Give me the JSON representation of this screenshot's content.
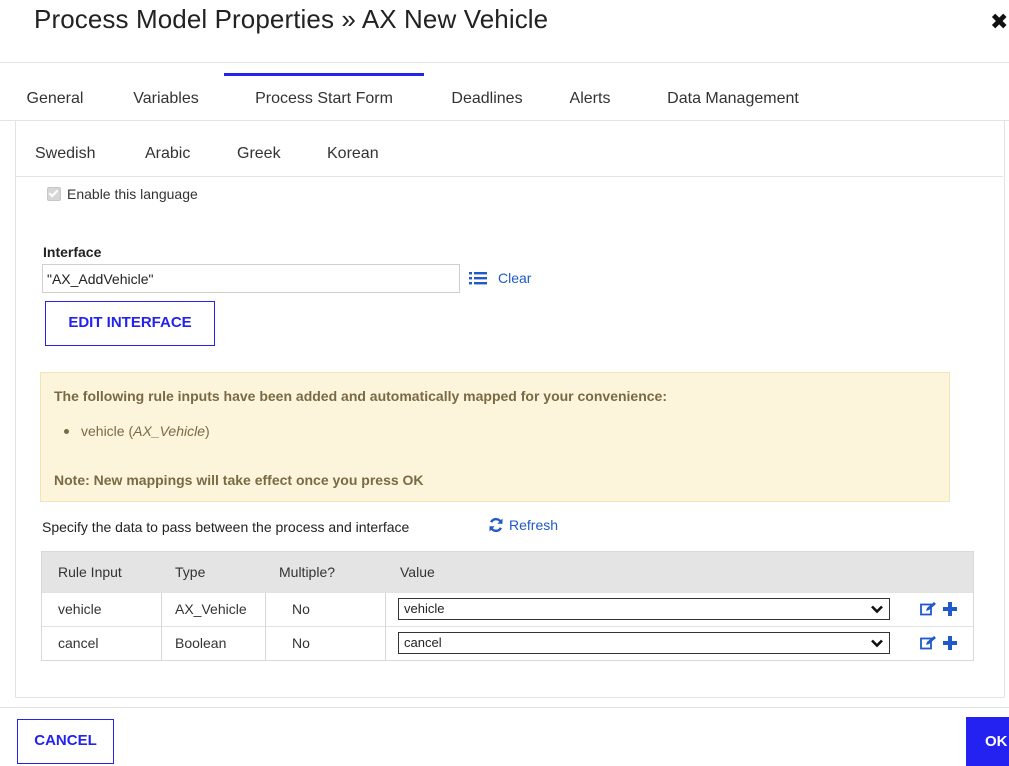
{
  "dialog": {
    "title": "Process Model Properties » AX New Vehicle",
    "close_icon": "close-icon"
  },
  "tabs": [
    {
      "label": "General",
      "active": false
    },
    {
      "label": "Variables",
      "active": false
    },
    {
      "label": "Process Start Form",
      "active": true
    },
    {
      "label": "Deadlines",
      "active": false
    },
    {
      "label": "Alerts",
      "active": false
    },
    {
      "label": "Data Management",
      "active": false
    }
  ],
  "languages": [
    "Swedish",
    "Arabic",
    "Greek",
    "Korean"
  ],
  "enable_language": {
    "label": "Enable this language",
    "checked": true,
    "disabled": true
  },
  "interface": {
    "label": "Interface",
    "value": "\"AX_AddVehicle\"",
    "list_icon": "list-icon",
    "clear_label": "Clear",
    "edit_button": "EDIT INTERFACE"
  },
  "notice": {
    "heading": "The following rule inputs have been added and automatically mapped for your convenience:",
    "items": [
      {
        "name": "vehicle",
        "type": "AX_Vehicle"
      }
    ],
    "note": "Note: New mappings will take effect once you press OK"
  },
  "mapping": {
    "description": "Specify the data to pass between the process and interface",
    "refresh_label": "Refresh",
    "headers": [
      "Rule Input",
      "Type",
      "Multiple?",
      "Value"
    ],
    "rows": [
      {
        "rule_input": "vehicle",
        "type": "AX_Vehicle",
        "multiple": "No",
        "value": "vehicle"
      },
      {
        "rule_input": "cancel",
        "type": "Boolean",
        "multiple": "No",
        "value": "cancel"
      }
    ],
    "row_icons": [
      "edit-icon",
      "plus-icon"
    ]
  },
  "footer": {
    "cancel_label": "CANCEL",
    "ok_label": "OK"
  },
  "colors": {
    "accent": "#2322f0",
    "link": "#2059c9",
    "notice_bg": "#fcf5dc",
    "notice_text": "#7a6a44",
    "table_header_bg": "#e4e4e4"
  }
}
